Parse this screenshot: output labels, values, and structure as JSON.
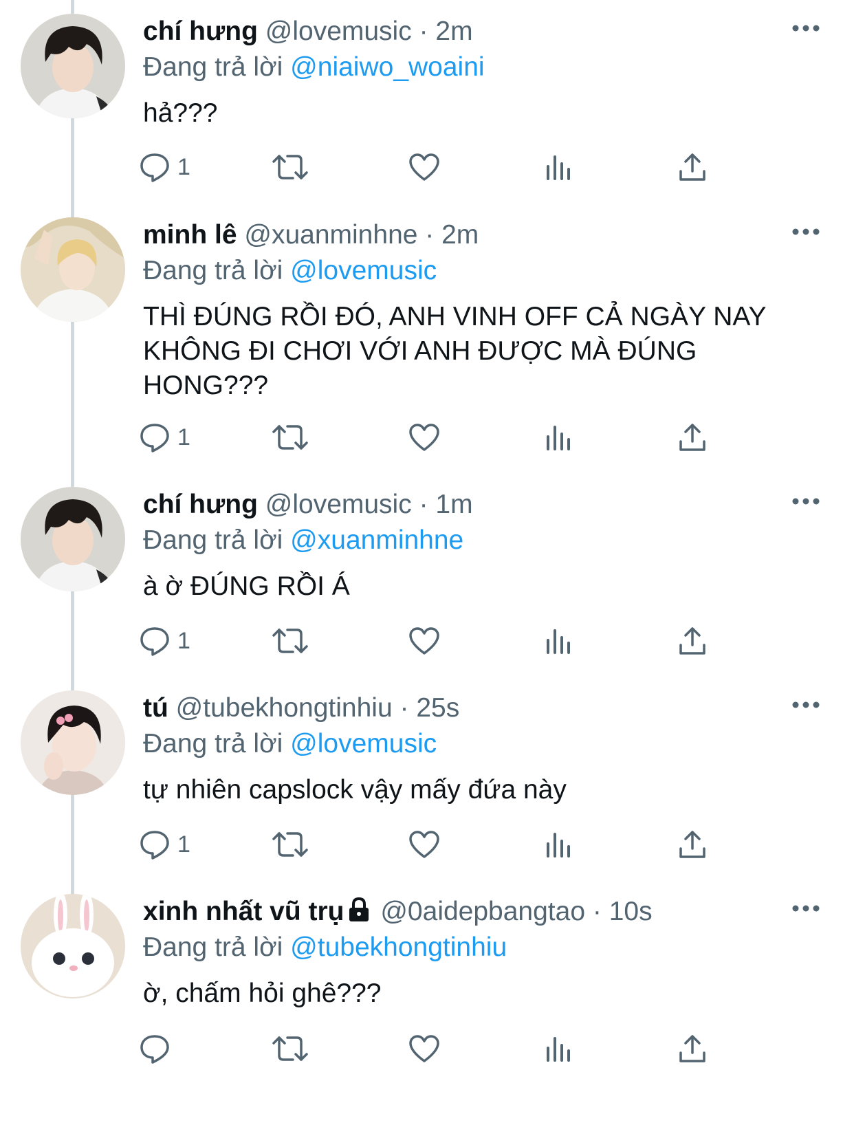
{
  "tweets": [
    {
      "name": "chí hưng",
      "handle": "@lovemusic",
      "time": "· 2m",
      "replying_prefix": "Đang trả lời",
      "replying_to": "@niaiwo_woaini",
      "text": "hả???",
      "reply_count": "1",
      "avatar": "boy-dark-hair-avatar",
      "locked": false
    },
    {
      "name": "minh lê",
      "handle": "@xuanminhne",
      "time": "· 2m",
      "replying_prefix": "Đang trả lời",
      "replying_to": "@lovemusic",
      "text": "THÌ ĐÚNG RỒI ĐÓ, ANH VINH OFF CẢ NGÀY NAY KHÔNG ĐI CHƠI VỚI ANH ĐƯỢC MÀ ĐÚNG HONG???",
      "reply_count": "1",
      "avatar": "blonde-boy-avatar",
      "locked": false
    },
    {
      "name": "chí hưng",
      "handle": "@lovemusic",
      "time": "· 1m",
      "replying_prefix": "Đang trả lời",
      "replying_to": "@xuanminhne",
      "text": "à ờ ĐÚNG RỒI Á",
      "reply_count": "1",
      "avatar": "boy-dark-hair-avatar",
      "locked": false
    },
    {
      "name": "tú",
      "handle": "@tubekhongtinhiu",
      "time": "· 25s",
      "replying_prefix": "Đang trả lời",
      "replying_to": "@lovemusic",
      "text": "tự nhiên capslock vậy mấy đứa này",
      "reply_count": "1",
      "avatar": "boy-hairclip-avatar",
      "locked": false
    },
    {
      "name": "xinh nhất vũ trụ",
      "handle": "@0aidepbangtao",
      "time": "· 10s",
      "replying_prefix": "Đang trả lời",
      "replying_to": "@tubekhongtinhiu",
      "text": "ờ, chấm hỏi ghê???",
      "reply_count": "",
      "avatar": "white-bunny-avatar",
      "locked": true
    }
  ],
  "icons": {
    "reply": "reply-icon",
    "retweet": "retweet-icon",
    "like": "heart-icon",
    "views": "views-icon",
    "share": "share-icon",
    "more": "more-icon",
    "lock": "lock-icon"
  },
  "colors": {
    "link": "#1d9bf0",
    "secondary": "#536471",
    "thread_line": "#cfd9de"
  }
}
